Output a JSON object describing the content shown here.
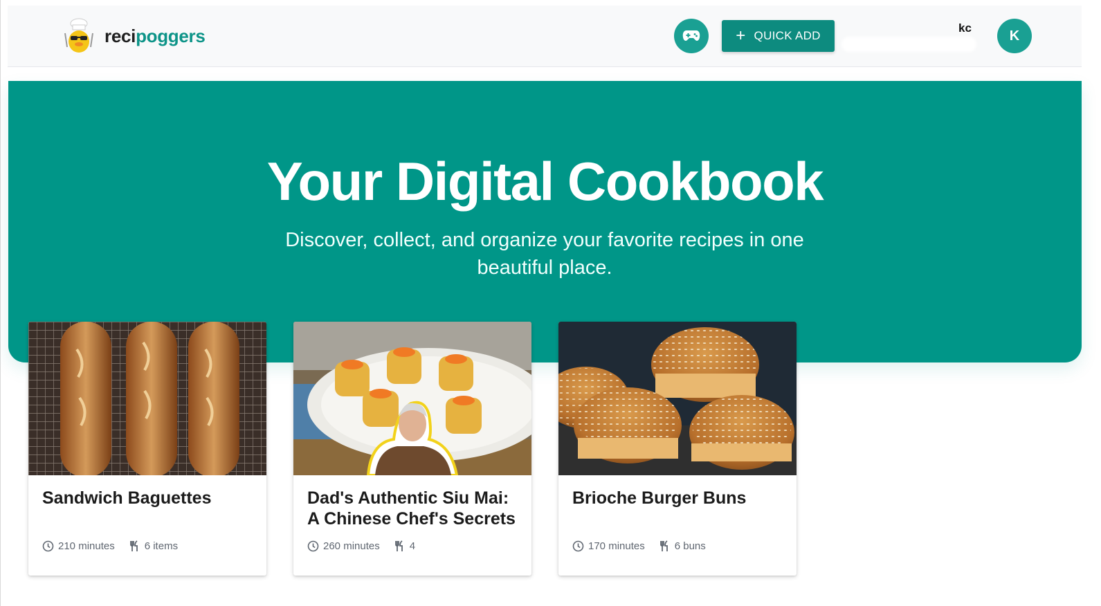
{
  "brand": {
    "part1": "reci",
    "part2": "poggers"
  },
  "header": {
    "quick_add_label": "QUICK ADD",
    "username": "kc",
    "avatar_initial": "K"
  },
  "hero": {
    "title": "Your Digital Cookbook",
    "subtitle": "Discover, collect, and organize your favorite recipes in one beautiful place."
  },
  "colors": {
    "primary": "#009688",
    "button": "#0d8b7f",
    "brand_accent": "#0d9488"
  },
  "recipes": [
    {
      "title": "Sandwich Baguettes",
      "time": "210 minutes",
      "yield": "6 items"
    },
    {
      "title": "Dad's Authentic Siu Mai: A Chinese Chef's Secrets",
      "time": "260 minutes",
      "yield": "4"
    },
    {
      "title": "Brioche Burger Buns",
      "time": "170 minutes",
      "yield": "6 buns"
    }
  ]
}
